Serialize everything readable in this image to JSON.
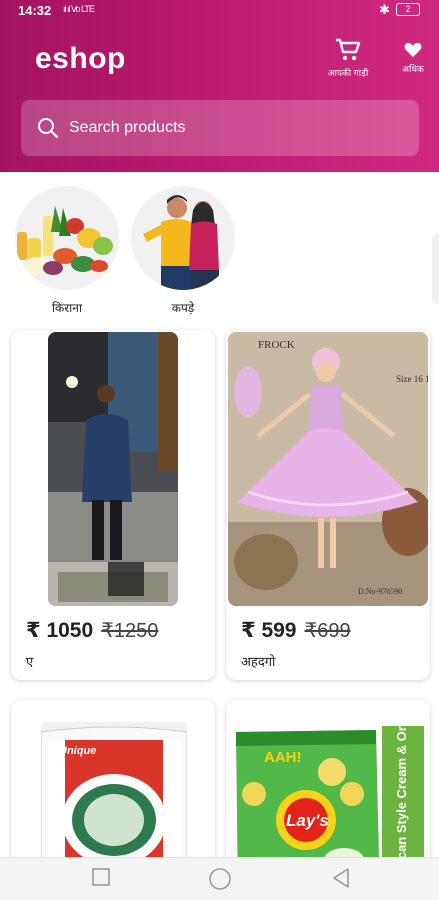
{
  "status_bar": {
    "time": "14:32",
    "signal": "ıl ıl Vo LTE",
    "bluetooth_icon": "bluetooth-icon",
    "battery": "2"
  },
  "header": {
    "brand": "eshop",
    "cart_label": "आपकी गाड़ी",
    "more_label": "अधिक",
    "cart_icon": "cart-icon",
    "more_icon": "heart-icon"
  },
  "search": {
    "placeholder": "Search products",
    "icon": "search-icon"
  },
  "categories": [
    {
      "label": "किराना"
    },
    {
      "label": "कपड़े"
    }
  ],
  "products": [
    {
      "price": "₹ 1050",
      "mrp": "₹1250",
      "name": "ए"
    },
    {
      "price": "₹ 599",
      "mrp": "₹699",
      "name": "अहदगो"
    },
    {
      "price": "",
      "mrp": "",
      "name": ""
    },
    {
      "price": "",
      "mrp": "",
      "name": ""
    }
  ],
  "product_image_text": {
    "frock_title": "FROCK",
    "frock_sizes": "Size 16 18 20",
    "frock_code": "D.No-976590",
    "rice_brand": "Unique",
    "chips_tag": "AAH!",
    "chips_brand": "Lay's",
    "chips_flavour": "American Style Cream & Onion"
  },
  "colors": {
    "brand_primary": "#b8176b",
    "card_bg": "#ffffff"
  }
}
